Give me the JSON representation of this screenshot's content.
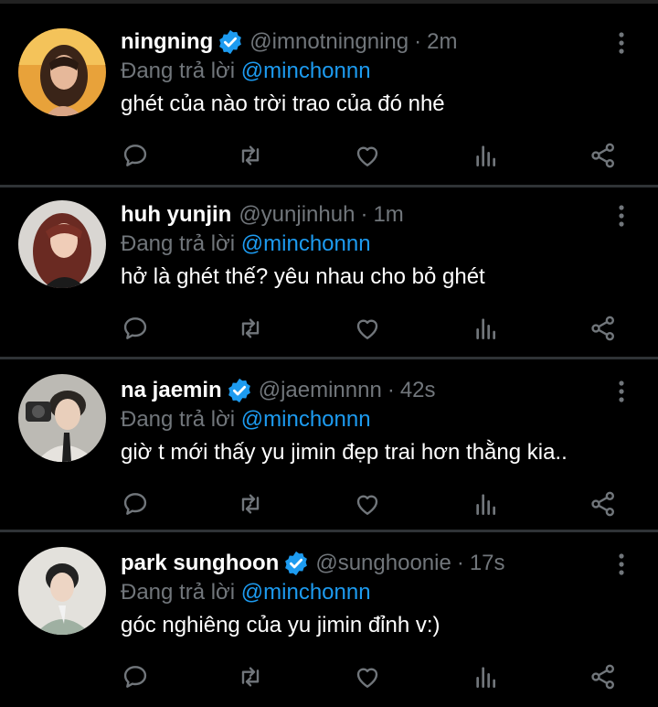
{
  "reply_prefix": "Đang trả lời",
  "colors": {
    "background": "#000000",
    "name": "#ffffff",
    "muted": "#71767b",
    "mention": "#1d9bf0",
    "verified": "#1d9bf0"
  },
  "icons": [
    "reply-icon",
    "retweet-icon",
    "like-icon",
    "stats-icon",
    "share-icon",
    "more-icon",
    "verified-badge-icon"
  ],
  "tweets": [
    {
      "name": "ningning",
      "verified": true,
      "handle": "@imnotningning",
      "time": "2m",
      "reply_to": "@minchonnn",
      "text": "ghét của nào trời trao của đó nhé"
    },
    {
      "name": "huh yunjin",
      "verified": false,
      "handle": "@yunjinhuh",
      "time": "1m",
      "reply_to": "@minchonnn",
      "text": "hở là ghét thế? yêu nhau cho bỏ ghét"
    },
    {
      "name": "na jaemin",
      "verified": true,
      "handle": "@jaeminnnn",
      "time": "42s",
      "reply_to": "@minchonnn",
      "text": "giờ t mới thấy yu jimin đẹp trai hơn thằng kia.."
    },
    {
      "name": "park sunghoon",
      "verified": true,
      "handle": "@sunghoonie",
      "time": "17s",
      "reply_to": "@minchonnn",
      "text": "góc nghiêng của yu jimin đỉnh v:)"
    }
  ]
}
